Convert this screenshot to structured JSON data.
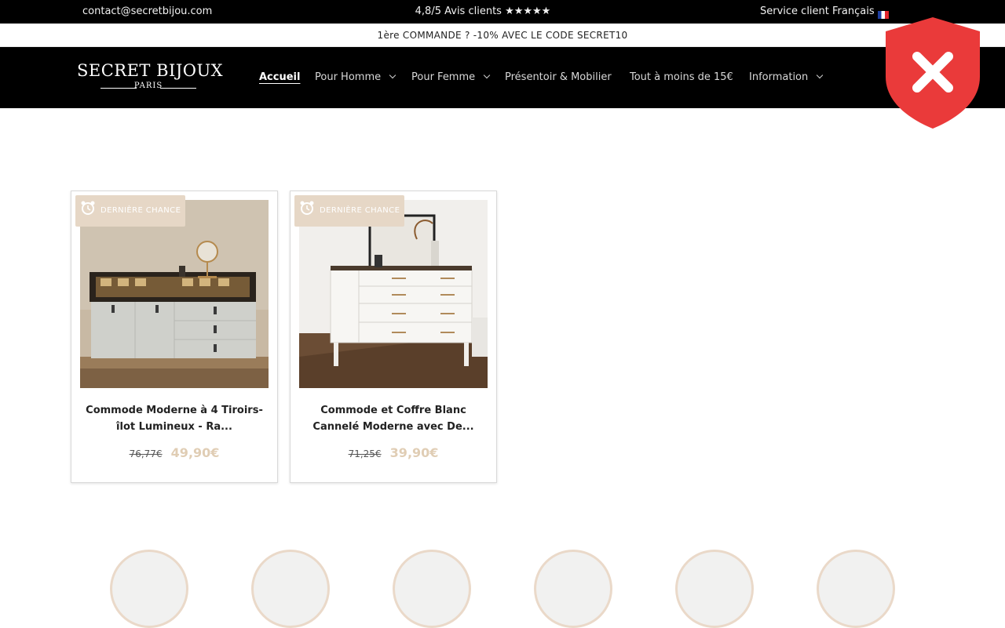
{
  "topbar": {
    "email": "contact@secretbijou.com",
    "rating": "4,8/5 Avis clients ★★★★★",
    "service": "Service client Français"
  },
  "announcement": "1ère COMMANDE ? -10% AVEC LE CODE SECRET10",
  "logo": {
    "name": "SECRET BIJOUX",
    "city": "PARIS"
  },
  "nav": {
    "items": [
      {
        "label": "Accueil",
        "active": true,
        "dropdown": false
      },
      {
        "label": "Pour Homme",
        "active": false,
        "dropdown": true
      },
      {
        "label": "Pour Femme",
        "active": false,
        "dropdown": true
      },
      {
        "label": "Présentoir & Mobilier",
        "active": false,
        "dropdown": false
      },
      {
        "label": "Tout à moins de 15€",
        "active": false,
        "dropdown": false
      },
      {
        "label": "Information",
        "active": false,
        "dropdown": true
      }
    ]
  },
  "badge_icon": "shield-x-icon",
  "products": [
    {
      "badge": "DERNIÈRE CHANCE",
      "title": "Commode Moderne à 4 Tiroirs- îlot Lumineux - Ra...",
      "old_price": "76,77€",
      "price": "49,90€"
    },
    {
      "badge": "DERNIÈRE CHANCE",
      "title": "Commode et Coffre Blanc Cannelé Moderne avec De...",
      "old_price": "71,25€",
      "price": "39,90€"
    }
  ],
  "colors": {
    "topbar_bg": "#000000",
    "accent_beige": "#e6d7c6",
    "price_color": "#e0cdb4",
    "shield_red": "#ea3a3a"
  }
}
